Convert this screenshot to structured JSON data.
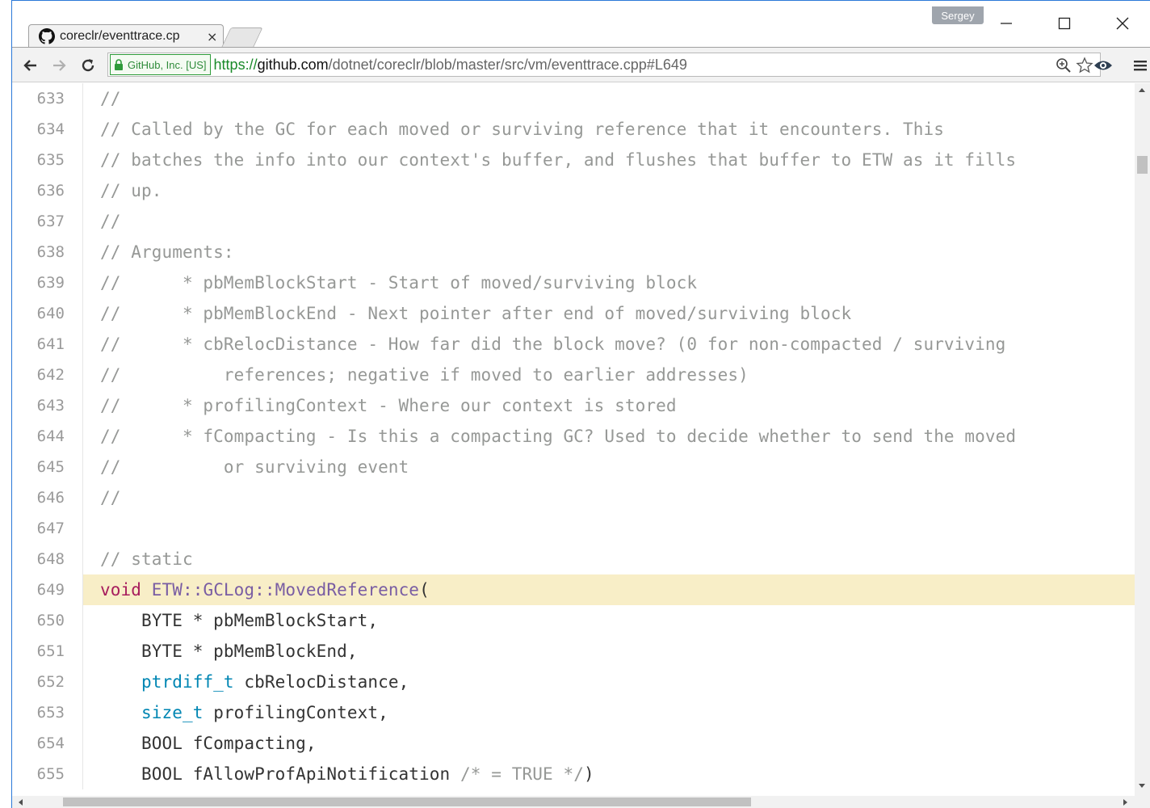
{
  "window": {
    "profile_name": "Sergey",
    "minimize_icon": "minimize-icon",
    "maximize_icon": "maximize-icon",
    "close_icon": "close-icon"
  },
  "tab": {
    "title": "coreclr/eventtrace.cp",
    "favicon": "github-icon",
    "close_label": "×"
  },
  "toolbar": {
    "back_icon": "back-arrow-icon",
    "forward_icon": "forward-arrow-icon",
    "reload_icon": "reload-icon",
    "ev_label": "GitHub, Inc. [US]",
    "url_scheme": "https://",
    "url_host": "github.com",
    "url_path": "/dotnet/coreclr/blob/master/src/vm/eventtrace.cpp#L649",
    "zoom_icon": "zoom-icon",
    "bookmark_icon": "star-icon",
    "extension_icon": "eye-extension-icon",
    "menu_icon": "hamburger-menu-icon"
  },
  "colors": {
    "comment": "#969896",
    "keyword": "#a71d5d",
    "function": "#795da3",
    "type": "#0086b3",
    "highlight": "#f8eec7"
  },
  "code": {
    "highlighted_line": "649",
    "lines": [
      {
        "num": "633",
        "tokens": [
          {
            "t": "//",
            "c": "comment"
          }
        ]
      },
      {
        "num": "634",
        "tokens": [
          {
            "t": "// Called by the GC for each moved or surviving reference that it encounters. This",
            "c": "comment"
          }
        ]
      },
      {
        "num": "635",
        "tokens": [
          {
            "t": "// batches the info into our context's buffer, and flushes that buffer to ETW as it fills",
            "c": "comment"
          }
        ]
      },
      {
        "num": "636",
        "tokens": [
          {
            "t": "// up.",
            "c": "comment"
          }
        ]
      },
      {
        "num": "637",
        "tokens": [
          {
            "t": "//",
            "c": "comment"
          }
        ]
      },
      {
        "num": "638",
        "tokens": [
          {
            "t": "// Arguments:",
            "c": "comment"
          }
        ]
      },
      {
        "num": "639",
        "tokens": [
          {
            "t": "//      * pbMemBlockStart - Start of moved/surviving block",
            "c": "comment"
          }
        ]
      },
      {
        "num": "640",
        "tokens": [
          {
            "t": "//      * pbMemBlockEnd - Next pointer after end of moved/surviving block",
            "c": "comment"
          }
        ]
      },
      {
        "num": "641",
        "tokens": [
          {
            "t": "//      * cbRelocDistance - How far did the block move? (0 for non-compacted / surviving",
            "c": "comment"
          }
        ]
      },
      {
        "num": "642",
        "tokens": [
          {
            "t": "//          references; negative if moved to earlier addresses)",
            "c": "comment"
          }
        ]
      },
      {
        "num": "643",
        "tokens": [
          {
            "t": "//      * profilingContext - Where our context is stored",
            "c": "comment"
          }
        ]
      },
      {
        "num": "644",
        "tokens": [
          {
            "t": "//      * fCompacting - Is this a compacting GC? Used to decide whether to send the moved",
            "c": "comment"
          }
        ]
      },
      {
        "num": "645",
        "tokens": [
          {
            "t": "//          or surviving event",
            "c": "comment"
          }
        ]
      },
      {
        "num": "646",
        "tokens": [
          {
            "t": "//",
            "c": "comment"
          }
        ]
      },
      {
        "num": "647",
        "tokens": []
      },
      {
        "num": "648",
        "tokens": [
          {
            "t": "// static",
            "c": "comment"
          }
        ]
      },
      {
        "num": "649",
        "tokens": [
          {
            "t": "void",
            "c": "kw"
          },
          {
            "t": " ",
            "c": "plain"
          },
          {
            "t": "ETW::GCLog::MovedReference",
            "c": "fn"
          },
          {
            "t": "(",
            "c": "plain"
          }
        ]
      },
      {
        "num": "650",
        "tokens": [
          {
            "t": "    BYTE * pbMemBlockStart,",
            "c": "plain"
          }
        ]
      },
      {
        "num": "651",
        "tokens": [
          {
            "t": "    BYTE * pbMemBlockEnd,",
            "c": "plain"
          }
        ]
      },
      {
        "num": "652",
        "tokens": [
          {
            "t": "    ",
            "c": "plain"
          },
          {
            "t": "ptrdiff_t",
            "c": "type"
          },
          {
            "t": " cbRelocDistance,",
            "c": "plain"
          }
        ]
      },
      {
        "num": "653",
        "tokens": [
          {
            "t": "    ",
            "c": "plain"
          },
          {
            "t": "size_t",
            "c": "type"
          },
          {
            "t": " profilingContext,",
            "c": "plain"
          }
        ]
      },
      {
        "num": "654",
        "tokens": [
          {
            "t": "    BOOL fCompacting,",
            "c": "plain"
          }
        ]
      },
      {
        "num": "655",
        "tokens": [
          {
            "t": "    BOOL fAllowProfApiNotification ",
            "c": "plain"
          },
          {
            "t": "/* = TRUE */",
            "c": "comment"
          },
          {
            "t": ")",
            "c": "plain"
          }
        ]
      }
    ]
  }
}
